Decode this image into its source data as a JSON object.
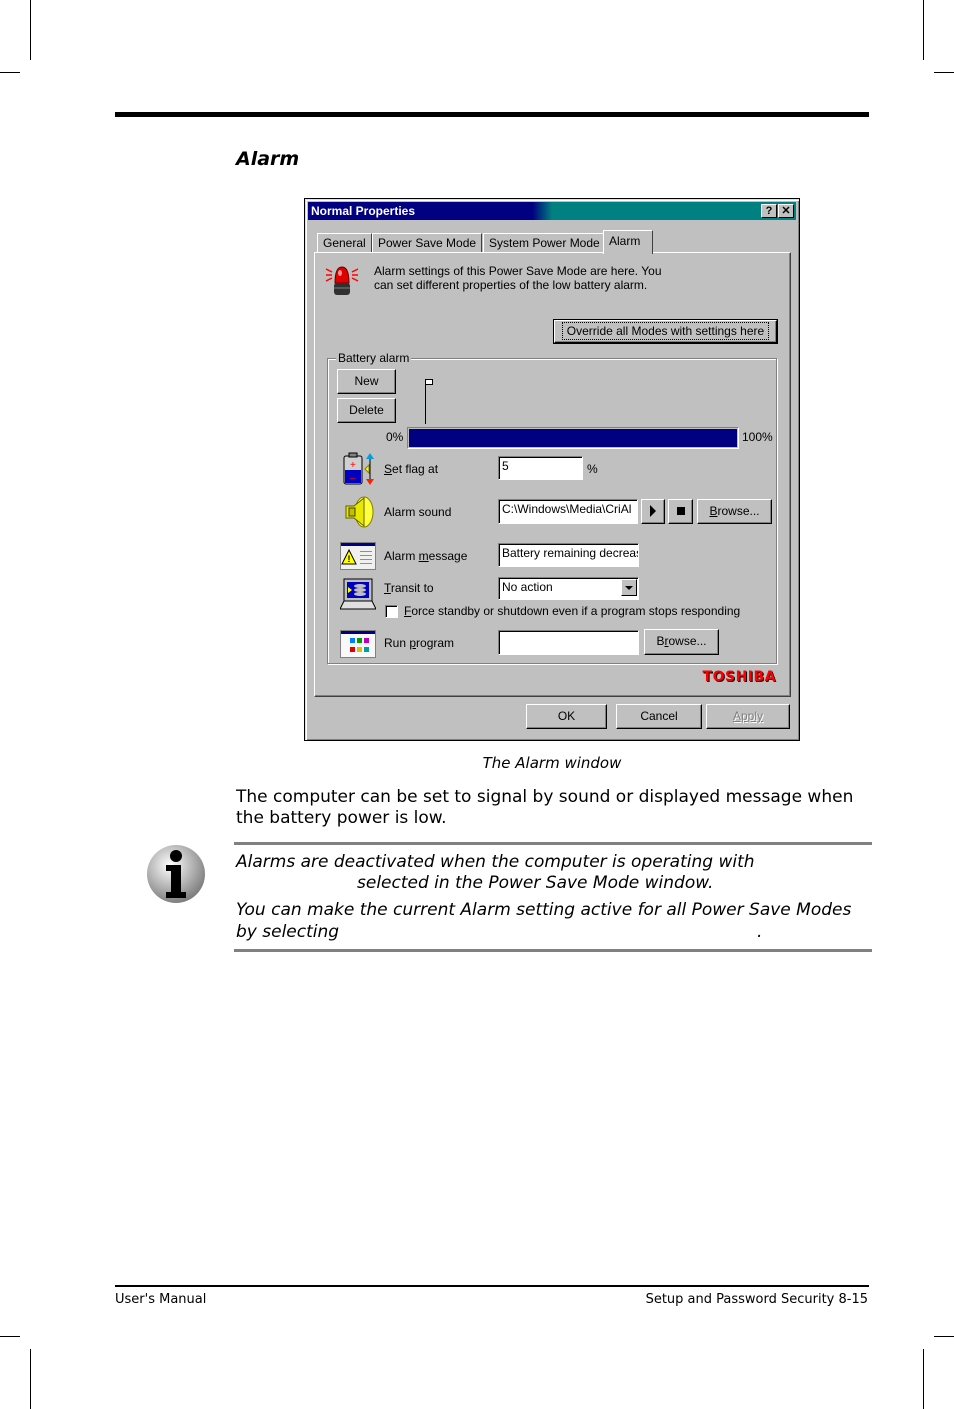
{
  "page": {
    "section_title": "Alarm",
    "figure_caption": "The Alarm window",
    "body_paragraph": "The computer can be set to signal by sound or displayed message when the battery power is low.",
    "note": {
      "icon": "info-icon",
      "line1": "Alarms are deactivated when the computer is operating with",
      "line2": "selected in the Power Save Mode window.",
      "line3": "You can make the current Alarm setting active for all Power Save Modes",
      "line4": "by selecting",
      "line4_end": "."
    },
    "footer": {
      "left": "User's Manual",
      "right": "Setup and Password Security  8-15"
    }
  },
  "dialog": {
    "title": "Normal Properties",
    "help_button": "?",
    "close_button": "✕",
    "tabs": [
      {
        "label": "General",
        "active": false
      },
      {
        "label": "Power Save Mode",
        "active": false
      },
      {
        "label": "System Power Mode",
        "active": false
      },
      {
        "label": "Alarm",
        "active": true
      }
    ],
    "header_icon": "alarm-siren-icon",
    "description_line1": "Alarm settings of this Power Save Mode are here. You",
    "description_line2": "can set different properties of the low battery alarm.",
    "override_button": "Override all Modes with settings here",
    "battery_alarm": {
      "group_label": "Battery alarm",
      "new_button": "New",
      "delete_button": "Delete",
      "scale_min_label": "0%",
      "scale_max_label": "100%",
      "bar_fill_percent": 100,
      "flag_position_percent": 5
    },
    "set_flag": {
      "icon": "battery-level-icon",
      "label": "Set flag at",
      "value": "5",
      "unit": "%"
    },
    "alarm_sound": {
      "icon": "speaker-icon",
      "label": "Alarm sound",
      "value": "C:\\Windows\\Media\\CriAl",
      "play_icon": "play-icon",
      "stop_icon": "stop-icon",
      "browse_button": "Browse..."
    },
    "alarm_message": {
      "icon": "warning-message-icon",
      "label": "Alarm message",
      "value": "Battery remaining decreas"
    },
    "transit_to": {
      "icon": "laptop-icon",
      "label": "Transit to",
      "selected": "No action"
    },
    "force_checkbox": {
      "label": "Force standby or shutdown even if a program stops responding",
      "checked": false
    },
    "run_program": {
      "icon": "program-window-icon",
      "label": "Run program",
      "value": "",
      "browse_button": "Browse..."
    },
    "brand_logo": "TOSHIBA",
    "ok_button": "OK",
    "cancel_button": "Cancel",
    "apply_button": "Apply"
  },
  "colors": {
    "titlebar_active": "#000080",
    "titlebar_gradient_end": "#008080",
    "window_face": "#c0c0c0",
    "progress_fill": "#000080",
    "brand_red": "#ff0000"
  }
}
